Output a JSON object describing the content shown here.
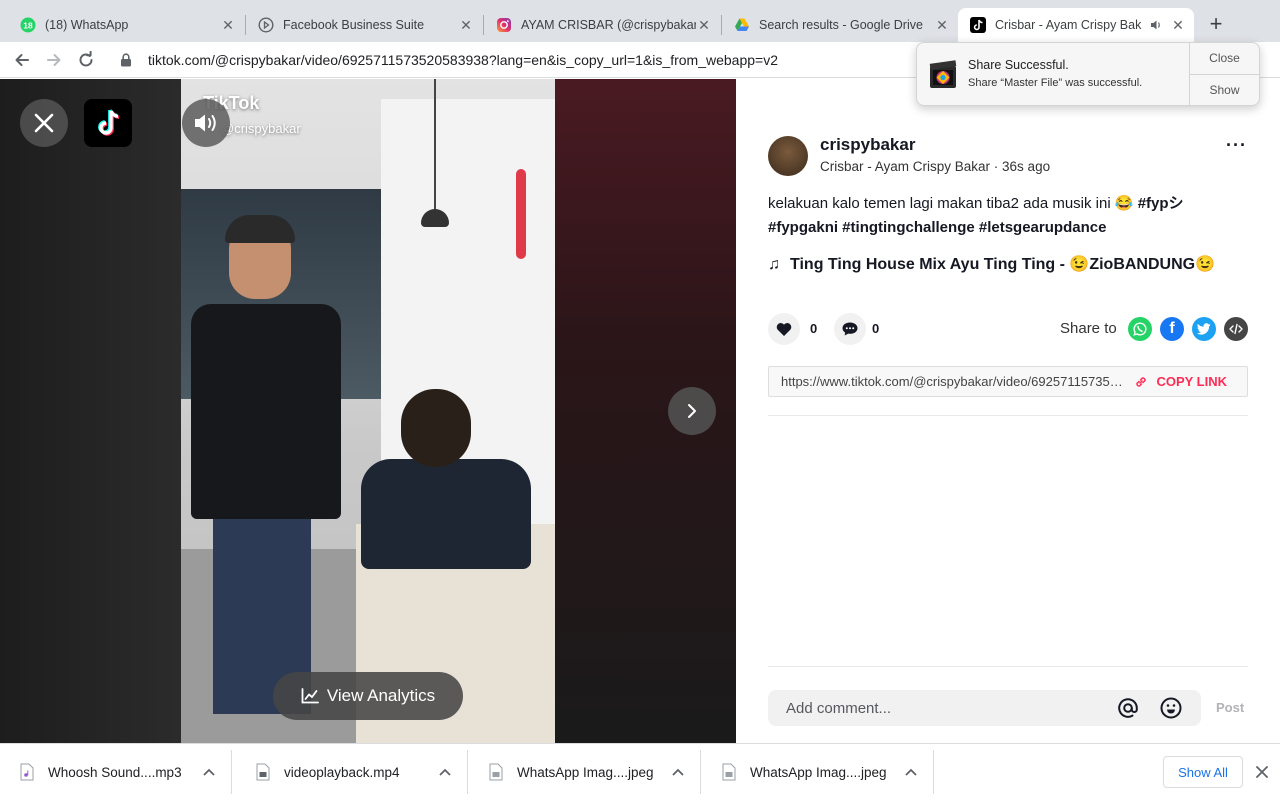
{
  "tabs": [
    {
      "title": "(18) WhatsApp",
      "badge": "18",
      "icon": "whatsapp-icon",
      "active": false
    },
    {
      "title": "Facebook Business Suite",
      "icon": "facebook-business-icon",
      "active": false
    },
    {
      "title": "AYAM CRISBAR (@crispybakar",
      "icon": "instagram-icon",
      "active": false
    },
    {
      "title": "Search results - Google Drive",
      "icon": "google-drive-icon",
      "active": false
    },
    {
      "title": "Crisbar - Ayam Crispy Bak",
      "icon": "tiktok-icon",
      "active": true
    }
  ],
  "toolbar": {
    "url": "tiktok.com/@crispybakar/video/6925711573520583938?lang=en&is_copy_url=1&is_from_webapp=v2"
  },
  "notification": {
    "title": "Share Successful.",
    "body": "Share “Master File” was successful.",
    "close_label": "Close",
    "show_label": "Show",
    "app_icon": "final-cut-pro-icon"
  },
  "video": {
    "watermark": "TikTok",
    "watermark_user": "@crispybakar",
    "analytics_label": "View Analytics"
  },
  "post": {
    "username": "crispybakar",
    "subtitle": "Crisbar - Ayam Crispy Bakar · 36s ago",
    "caption_text": "kelakuan kalo temen lagi makan tiba2 ada musik ini 😂 ",
    "caption_tags": "#fypシ #fypgakni #tingtingchallenge #letsgearupdance",
    "music": "Ting Ting House Mix Ayu Ting Ting - 😉ZioBANDUNG😉",
    "likes": "0",
    "comments": "0",
    "share_label": "Share to",
    "share_targets": [
      "whatsapp-icon",
      "facebook-icon",
      "twitter-icon",
      "embed-icon"
    ],
    "link": "https://www.tiktok.com/@crispybakar/video/6925711573520583938?lang=en&is_copy_url=1&is_from_webapp=v2",
    "copy_label": "COPY LINK",
    "comment_placeholder": "Add comment...",
    "post_label": "Post"
  },
  "downloads": {
    "items": [
      "Whoosh Sound....mp3",
      "videoplayback.mp4",
      "WhatsApp Imag....jpeg",
      "WhatsApp Imag....jpeg"
    ],
    "show_all_label": "Show All"
  },
  "colors": {
    "accent": "#fe2c55",
    "whatsapp": "#25d366",
    "facebook": "#1877f2",
    "twitter": "#1da1f2",
    "embed": "#454545"
  }
}
